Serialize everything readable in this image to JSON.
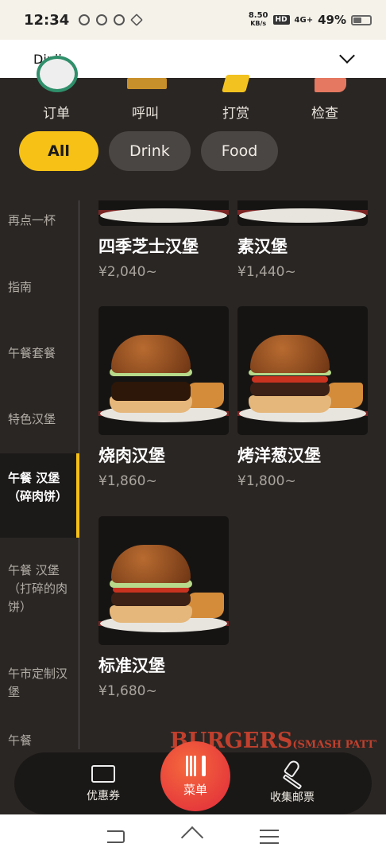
{
  "status_bar": {
    "time": "12:34",
    "speed_value": "8.50",
    "speed_unit": "KB/s",
    "hd_badge": "HD",
    "network": "4G+",
    "battery": "49%"
  },
  "header": {
    "title": "Dinii",
    "dropdown_icon": "chevron-down-icon"
  },
  "top_nav": [
    {
      "label": "订单",
      "icon": "clock-icon"
    },
    {
      "label": "呼叫",
      "icon": "bell-icon"
    },
    {
      "label": "打赏",
      "icon": "coin-icon"
    },
    {
      "label": "检查",
      "icon": "receipt-icon"
    }
  ],
  "filters": [
    {
      "label": "All",
      "active": true
    },
    {
      "label": "Drink",
      "active": false
    },
    {
      "label": "Food",
      "active": false
    }
  ],
  "categories": [
    {
      "label": "再点一杯",
      "active": false
    },
    {
      "label": "指南",
      "active": false
    },
    {
      "label": "午餐套餐",
      "active": false
    },
    {
      "label": "特色汉堡",
      "active": false
    },
    {
      "label": "午餐 汉堡（碎肉饼）",
      "active": true
    },
    {
      "label": "午餐 汉堡（打碎的肉饼）",
      "active": false
    },
    {
      "label": "午市定制汉堡",
      "active": false
    },
    {
      "label": "午餐",
      "active": false
    }
  ],
  "products": [
    {
      "name": "四季芝士汉堡",
      "price": "¥2,040~"
    },
    {
      "name": "素汉堡",
      "price": "¥1,440~"
    },
    {
      "name": "烧肉汉堡",
      "price": "¥1,860~"
    },
    {
      "name": "烤洋葱汉堡",
      "price": "¥1,800~"
    },
    {
      "name": "标准汉堡",
      "price": "¥1,680~"
    }
  ],
  "section_banner": {
    "main": "BURGERS",
    "sub": "(SMASH PATTY)"
  },
  "bottom_nav": {
    "coupon": "优惠券",
    "menu": "菜单",
    "stamps": "收集邮票"
  },
  "colors": {
    "accent": "#f7c116",
    "background": "#2a2624",
    "menu_button": "#e9373a",
    "banner": "#c0402d"
  }
}
